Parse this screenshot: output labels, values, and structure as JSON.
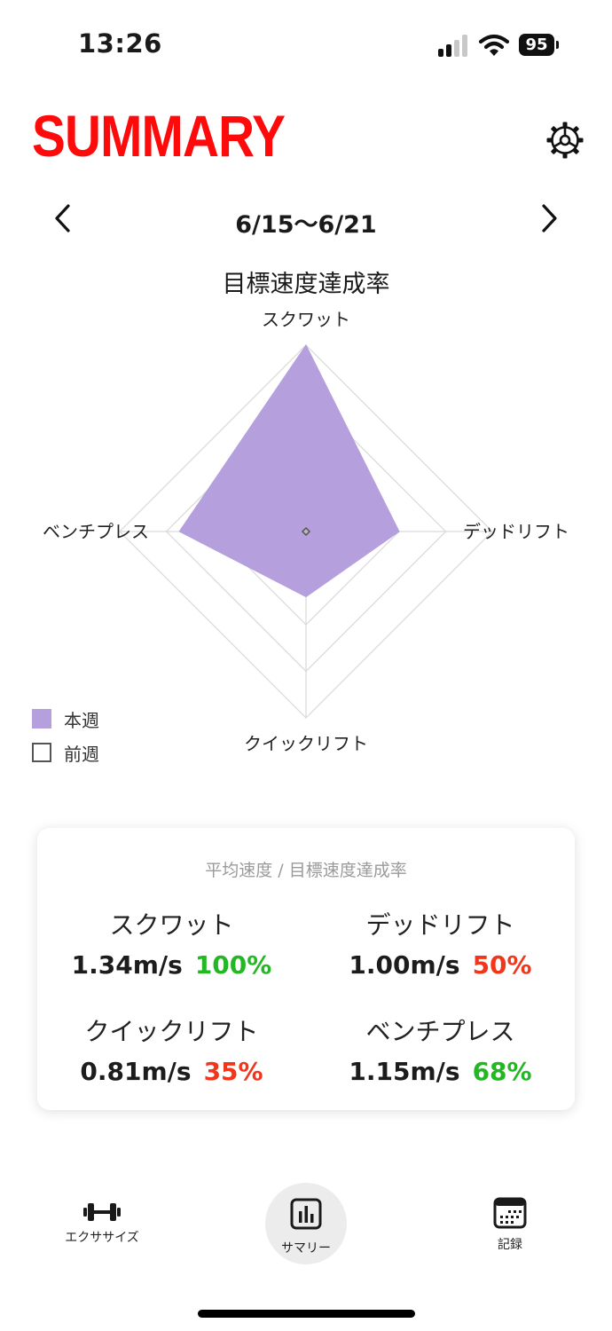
{
  "status_bar": {
    "time": "13:26",
    "battery": "95"
  },
  "header": {
    "title": "SUMMARY",
    "settings_icon": "gear-icon"
  },
  "period": {
    "label": "6/15～6/21",
    "prev_icon": "chevron-left-icon",
    "next_icon": "chevron-right-icon"
  },
  "chart_data": {
    "type": "radar",
    "title": "目標速度達成率",
    "axes": [
      "スクワット",
      "デッドリフト",
      "クイックリフト",
      "ベンチプレス"
    ],
    "range": [
      0,
      100
    ],
    "grid_levels": 4,
    "series": [
      {
        "name": "本週",
        "values": [
          100,
          50,
          35,
          68
        ],
        "color": "#b59fdc"
      },
      {
        "name": "前週",
        "values": [
          0,
          0,
          0,
          0
        ],
        "color": "#555555"
      }
    ]
  },
  "legend": {
    "this_week": "本週",
    "last_week": "前週"
  },
  "summary_card": {
    "title": "平均速度 / 目標速度達成率",
    "items": [
      {
        "name": "スクワット",
        "speed": "1.34m/s",
        "rate": "100%",
        "status": "good"
      },
      {
        "name": "デッドリフト",
        "speed": "1.00m/s",
        "rate": "50%",
        "status": "bad"
      },
      {
        "name": "クイックリフト",
        "speed": "0.81m/s",
        "rate": "35%",
        "status": "bad"
      },
      {
        "name": "ベンチプレス",
        "speed": "1.15m/s",
        "rate": "68%",
        "status": "good"
      }
    ],
    "colors": {
      "good": "#23b723",
      "bad": "#f2361c"
    }
  },
  "tab_bar": {
    "tabs": [
      {
        "label": "エクササイズ",
        "icon": "dumbbell-icon"
      },
      {
        "label": "サマリー",
        "icon": "bar-chart-icon",
        "active": true
      },
      {
        "label": "記録",
        "icon": "calendar-icon"
      }
    ]
  }
}
